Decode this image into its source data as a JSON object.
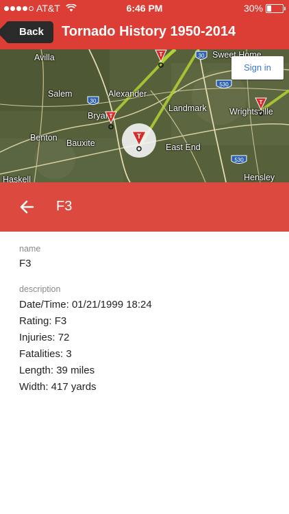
{
  "status_bar": {
    "carrier": "AT&T",
    "time": "6:46 PM",
    "battery": "30%",
    "battery_level": 0.3
  },
  "nav": {
    "back_label": "Back",
    "title": "Tornado History 1950-2014"
  },
  "map": {
    "sign_in_label": "Sign in",
    "place_labels": {
      "avilla": "Avilla",
      "sweet_home": "Sweet Home",
      "salem": "Salem",
      "alexander": "Alexander",
      "bryant": "Bryar",
      "landmark": "Landmark",
      "wrightsville": "Wrightsville",
      "benton": "Benton",
      "bauxite": "Bauxite",
      "east_end": "East End",
      "haskell": "Haskell",
      "hensley": "Hensley"
    },
    "highway_shields": {
      "i30_north": "30",
      "i30_south": "30",
      "i530_north": "530",
      "i530_south": "530"
    },
    "marker_glyph": "T"
  },
  "detail": {
    "title": "F3",
    "name_label": "name",
    "name_value": "F3",
    "description_label": "description",
    "description_lines": [
      "Date/Time: 01/21/1999 18:24",
      "Rating: F3",
      "Injuries: 72",
      "Fatalities: 3",
      "Length: 39 miles",
      "Width: 417 yards"
    ]
  },
  "colors": {
    "header_red": "#dc3d35",
    "detail_red": "#dc4a3f",
    "sign_in_blue": "#3b77d4",
    "track_green": "#b5d234"
  }
}
